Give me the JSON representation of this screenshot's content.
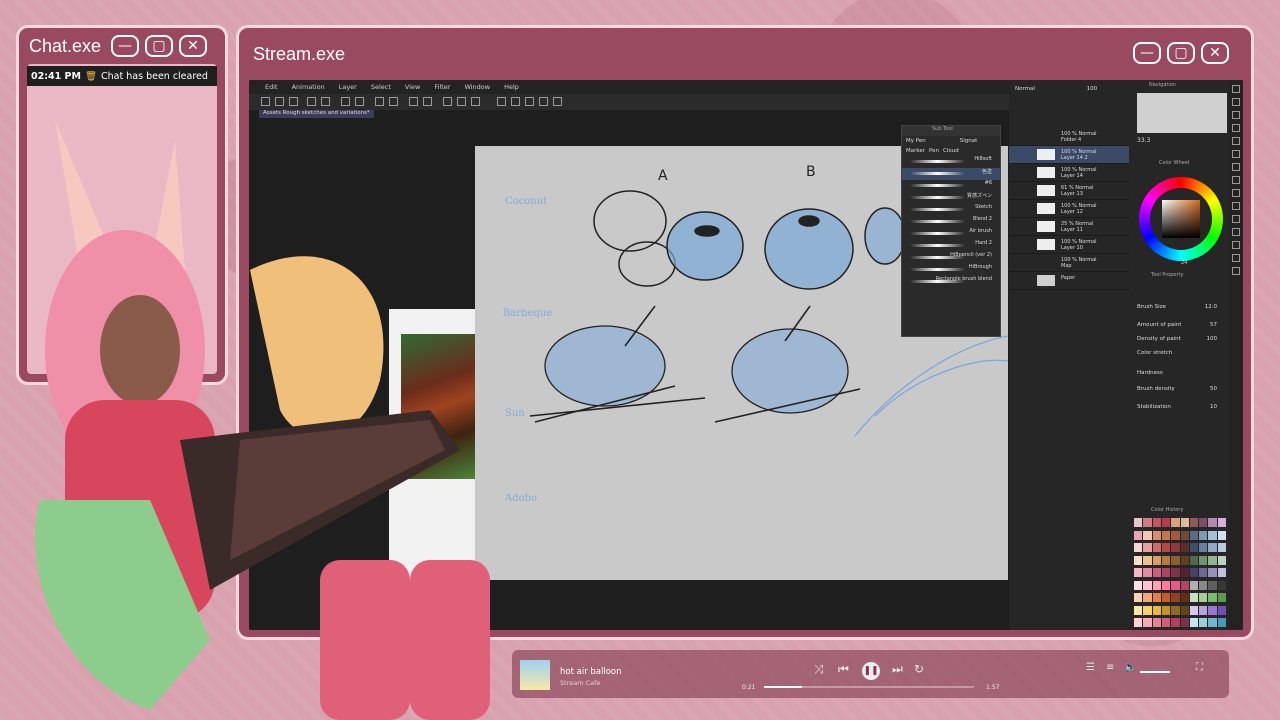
{
  "chat_window": {
    "title": "Chat.exe",
    "message": {
      "time": "02:41 PM",
      "icon": "trash-icon",
      "text": "Chat has been cleared"
    }
  },
  "stream_window": {
    "title": "Stream.exe",
    "app": {
      "menu": [
        "Edit",
        "Animation",
        "Layer",
        "Select",
        "View",
        "Filter",
        "Window",
        "Help"
      ],
      "canvas_tab": "Assets Rough sketches and variations*",
      "sketch_labels": {
        "column_a": "A",
        "column_b": "B",
        "row1": "Coconut",
        "row2": "Barbeque",
        "row3": "Sun",
        "row4": "Adobo"
      },
      "sub_tool": {
        "title": "Sub Tool",
        "tabs": [
          "My Pen",
          "Signat"
        ],
        "groups": [
          "Marker",
          "Pen",
          "Cloud"
        ],
        "brushes": [
          "Hi8soft",
          "色塗",
          "#6",
          "質感ズペン",
          "Sketch",
          "Blend 2",
          "Air brush",
          "Hard 2",
          "HiBpencil (ver 2)",
          "HiBrough",
          "Rectangle brush blend"
        ]
      },
      "layers": [
        {
          "blend": "100 % Normal",
          "name": "Folder 4"
        },
        {
          "blend": "100 % Normal",
          "name": "Layer 14 2"
        },
        {
          "blend": "100 % Normal",
          "name": "Layer 14"
        },
        {
          "blend": "61 % Normal",
          "name": "Layer 13"
        },
        {
          "blend": "100 % Normal",
          "name": "Layer 12"
        },
        {
          "blend": "25 % Normal",
          "name": "Layer 11"
        },
        {
          "blend": "100 % Normal",
          "name": "Layer 10"
        },
        {
          "blend": "100 % Normal",
          "name": "Map"
        },
        {
          "blend": "",
          "name": "Paper"
        }
      ],
      "layer_panel": {
        "mode": "Normal",
        "opacity": "100"
      },
      "navigator": {
        "title": "Navigation",
        "zoom": "33.3"
      },
      "color_wheel": {
        "title": "Color Wheel",
        "value": "24"
      },
      "tool_property": {
        "title": "Tool Property",
        "props": [
          {
            "label": "Brush Size",
            "value": "12.0"
          },
          {
            "label": "Amount of paint",
            "value": "57"
          },
          {
            "label": "Density of paint",
            "value": "100"
          },
          {
            "label": "Color stretch",
            "value": ""
          },
          {
            "label": "Hardness",
            "value": ""
          },
          {
            "label": "Brush density",
            "value": "50"
          },
          {
            "label": "Stabilization",
            "value": "10"
          }
        ]
      },
      "color_history": {
        "title": "Color History"
      }
    }
  },
  "player": {
    "song": "hot air balloon",
    "artist": "Stream Cafe",
    "elapsed": "0:21",
    "duration": "1:57",
    "progress": 0.18
  },
  "colors": {
    "window": "#9a4a60",
    "window_border": "#f6d9df",
    "background": "#d8a1ad",
    "sketch_blue": "#7ba8d9"
  },
  "palette_colors": [
    "#e8c7c8",
    "#cf7c88",
    "#c65262",
    "#b23d50",
    "#d9a27b",
    "#e0b99a",
    "#8a5a57",
    "#7d4b66",
    "#b48ab0",
    "#cfb4d6",
    "#e9a6b0",
    "#f0c5b8",
    "#dd8b70",
    "#c6764f",
    "#9e5b3f",
    "#6f4a3a",
    "#5d6b84",
    "#8198b3",
    "#a5bfd8",
    "#d2dfee",
    "#f4d6d6",
    "#e8a0a0",
    "#d36b6b",
    "#b14a4a",
    "#8f3a3a",
    "#5c2d2d",
    "#3f4f66",
    "#6b7fa0",
    "#92a8c7",
    "#b9cbe1",
    "#f7e1c6",
    "#ecc494",
    "#d9a15c",
    "#b67d3e",
    "#8c5d2e",
    "#5f3f20",
    "#4d6a4d",
    "#6f9270",
    "#93b394",
    "#bcd3bd",
    "#f2b6c6",
    "#e58aa3",
    "#cc5f80",
    "#a94663",
    "#803349",
    "#56222f",
    "#444466",
    "#6a6a92",
    "#9393bb",
    "#c0c0dd",
    "#ffe0e6",
    "#ffc4d2",
    "#ff9fb6",
    "#ff7aa0",
    "#e35b86",
    "#b8416a",
    "#b0b0b0",
    "#888888",
    "#606060",
    "#383838",
    "#f9d3b4",
    "#f1a978",
    "#e47f48",
    "#c15e2c",
    "#934221",
    "#652c16",
    "#c8e0c0",
    "#a6cc9a",
    "#7fb872",
    "#5c9b4f",
    "#fbe8a8",
    "#f5d36a",
    "#e8b93b",
    "#c4932a",
    "#91691f",
    "#604516",
    "#d8c8f0",
    "#b8a0e0",
    "#9878d0",
    "#7050b0",
    "#ffd0d8",
    "#f8a8b8",
    "#e88098",
    "#d06078",
    "#b04060",
    "#803048",
    "#c0e8f0",
    "#98d0e0",
    "#70b8d0",
    "#4898b8"
  ]
}
